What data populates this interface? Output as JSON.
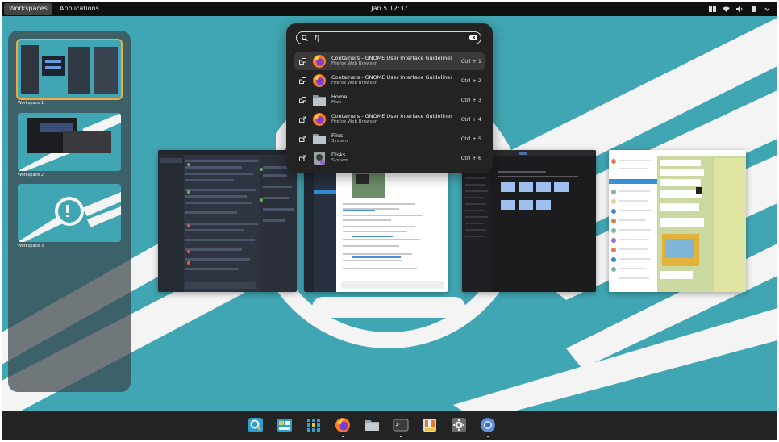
{
  "topbar": {
    "workspaces_label": "Workspaces",
    "applications_label": "Applications",
    "clock": "Jan 5  12:37"
  },
  "workspaces": [
    {
      "label": "Workspace 1",
      "selected": true
    },
    {
      "label": "Workspace 2",
      "selected": false
    },
    {
      "label": "Workspace 3",
      "selected": false
    }
  ],
  "search": {
    "query": "f|",
    "results": [
      {
        "title": "Containers - GNOME User Interface Guidelines...",
        "subtitle": "Firefox Web Browser",
        "shortcut": "Ctrl + 1",
        "icon": "firefox-icon",
        "action": "switch-window-icon"
      },
      {
        "title": "Containers - GNOME User Interface Guidelines...",
        "subtitle": "Firefox Web Browser",
        "shortcut": "Ctrl + 2",
        "icon": "firefox-icon",
        "action": "switch-window-icon"
      },
      {
        "title": "Home",
        "subtitle": "Files",
        "shortcut": "Ctrl + 3",
        "icon": "folder-icon",
        "action": "switch-window-icon"
      },
      {
        "title": "Containers - GNOME User Interface Guidelines...",
        "subtitle": "Firefox Web Browser",
        "shortcut": "Ctrl + 4",
        "icon": "firefox-icon",
        "action": "launch-icon"
      },
      {
        "title": "Files",
        "subtitle": "System",
        "shortcut": "Ctrl + 5",
        "icon": "folder-icon",
        "action": "launch-icon"
      },
      {
        "title": "Disks",
        "subtitle": "System",
        "shortcut": "Ctrl + 6",
        "icon": "disks-icon",
        "action": "launch-icon"
      }
    ]
  },
  "windows": [
    {
      "name": "chat-app-window",
      "theme": "dark"
    },
    {
      "name": "chat-browser-window",
      "theme": "light"
    },
    {
      "name": "files-dark-window",
      "theme": "dark"
    },
    {
      "name": "telegram-window",
      "theme": "light"
    }
  ],
  "dock": [
    {
      "name": "dock-search-icon",
      "running": false
    },
    {
      "name": "dock-workspaces-icon",
      "running": false
    },
    {
      "name": "dock-app-grid-icon",
      "running": false
    },
    {
      "name": "dock-firefox-icon",
      "running": true
    },
    {
      "name": "dock-files-icon",
      "running": false
    },
    {
      "name": "dock-terminal-icon",
      "running": true
    },
    {
      "name": "dock-store-icon",
      "running": false
    },
    {
      "name": "dock-settings-icon",
      "running": false
    },
    {
      "name": "dock-chromium-icon",
      "running": true
    }
  ],
  "colors": {
    "wallpaper": "#41a6b3",
    "panel": "#232323",
    "accent": "#f0a940"
  }
}
